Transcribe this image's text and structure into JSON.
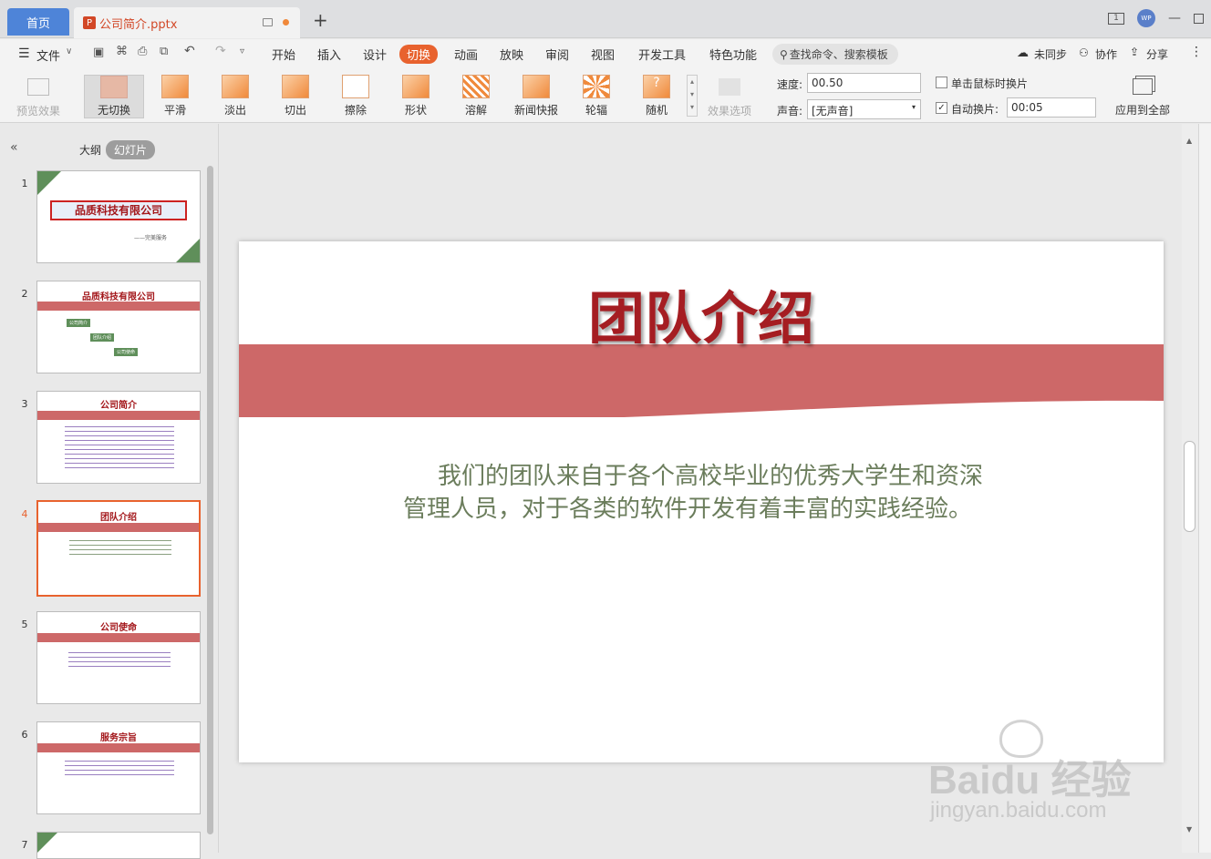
{
  "tabs": {
    "home": "首页",
    "file": "公司简介.pptx",
    "new": "+"
  },
  "window": {
    "page_indicator": "1",
    "avatar": "WP"
  },
  "menu": {
    "file": "文件",
    "items": [
      "开始",
      "插入",
      "设计",
      "切换",
      "动画",
      "放映",
      "审阅",
      "视图",
      "开发工具",
      "特色功能"
    ],
    "active": "切换",
    "search": "查找命令、搜索模板",
    "sync": "未同步",
    "collab": "协作",
    "share": "分享"
  },
  "ribbon": {
    "preview": "预览效果",
    "transitions": [
      "无切换",
      "平滑",
      "淡出",
      "切出",
      "擦除",
      "形状",
      "溶解",
      "新闻快报",
      "轮辐",
      "随机"
    ],
    "selected": "无切换",
    "effect_options": "效果选项",
    "speed_label": "速度:",
    "speed_value": "00.50",
    "sound_label": "声音:",
    "sound_value": "[无声音]",
    "click_advance": "单击鼠标时换片",
    "auto_advance": "自动换片:",
    "auto_time": "00:05",
    "apply_all": "应用到全部"
  },
  "pane": {
    "outline": "大纲",
    "slides": "幻灯片",
    "collapse": "«"
  },
  "thumbnails": [
    {
      "num": "1",
      "title": "品质科技有限公司",
      "sub": "——完美服务"
    },
    {
      "num": "2",
      "title": "品质科技有限公司",
      "items": [
        "公司简介",
        "团队介绍",
        "公司使命"
      ]
    },
    {
      "num": "3",
      "title": "公司简介"
    },
    {
      "num": "4",
      "title": "团队介绍"
    },
    {
      "num": "5",
      "title": "公司使命"
    },
    {
      "num": "6",
      "title": "服务宗旨"
    },
    {
      "num": "7",
      "title": ""
    }
  ],
  "slide": {
    "title": "团队介绍",
    "body": "我们的团队来自于各个高校毕业的优秀大学生和资深管理人员，对于各类的软件开发有着丰富的实践经验。"
  },
  "watermark": {
    "brand": "Baidu 经验",
    "url": "jingyan.baidu.com"
  },
  "colors": {
    "accent": "#e8622e",
    "title_red": "#a51d22",
    "band": "#cd6868",
    "body_green": "#6b7d5c",
    "home_tab": "#4e84d8"
  }
}
